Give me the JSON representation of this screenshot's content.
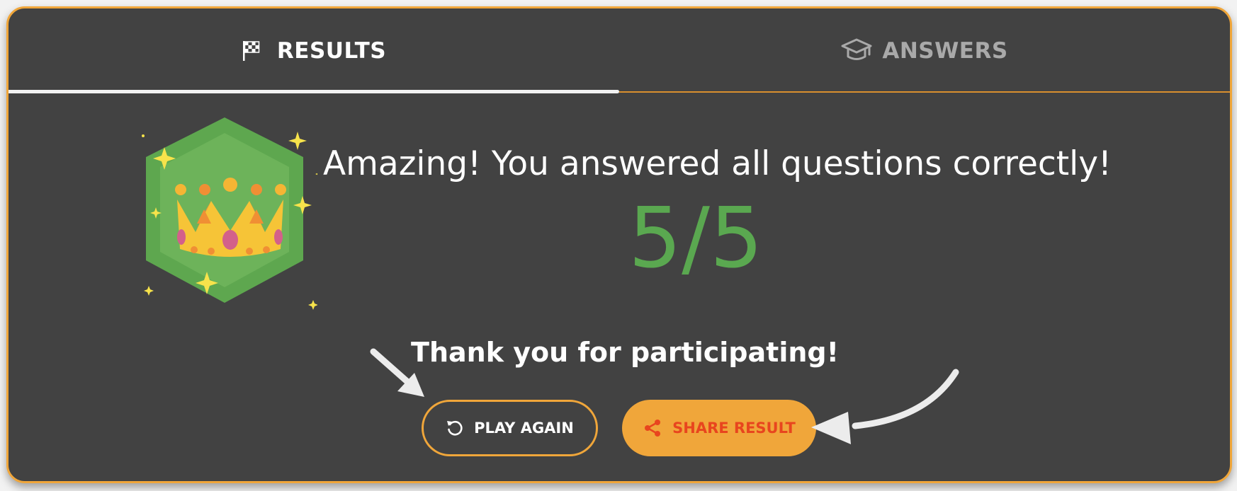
{
  "tabs": [
    {
      "label": "RESULTS",
      "icon": "checkered-flag-icon",
      "active": true
    },
    {
      "label": "ANSWERS",
      "icon": "graduation-cap-icon",
      "active": false
    }
  ],
  "result": {
    "headline": "Amazing! You answered all questions correctly!",
    "score": "5/5",
    "thanks": "Thank you for participating!",
    "badge_icon": "crown-badge-icon"
  },
  "actions": {
    "play_again": {
      "label": "PLAY AGAIN",
      "icon": "replay-icon"
    },
    "share_result": {
      "label": "SHARE RESULT",
      "icon": "share-icon"
    }
  },
  "colors": {
    "panel_bg": "#424242",
    "accent_orange": "#f0a63a",
    "score_green": "#5aa850",
    "share_text": "#e8451e"
  }
}
